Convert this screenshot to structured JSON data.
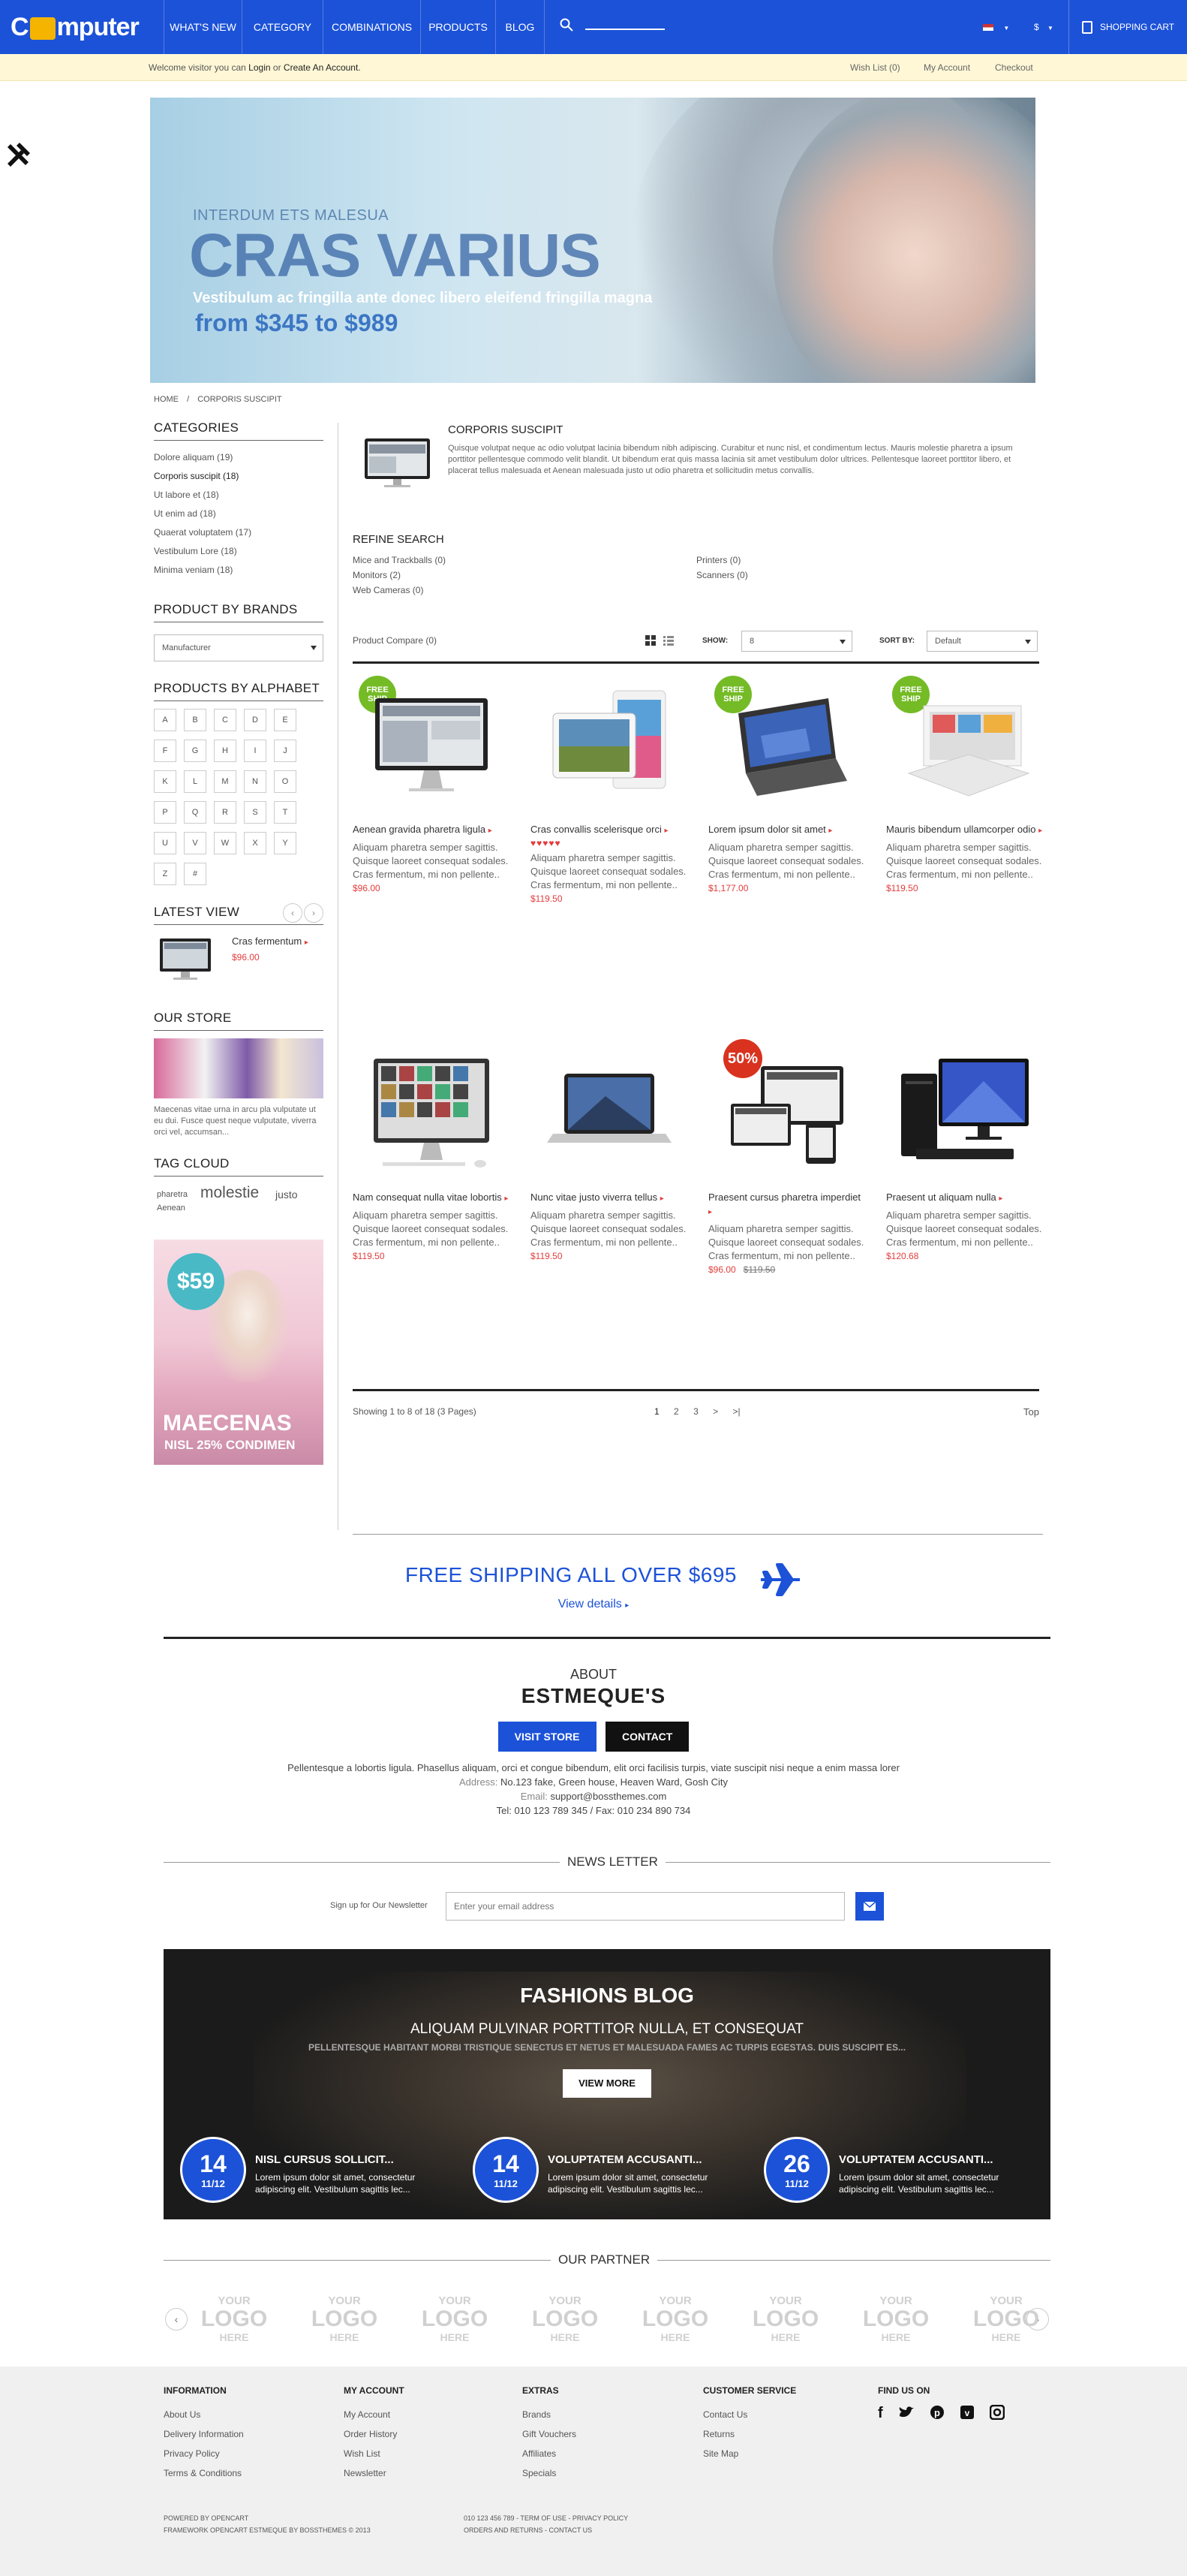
{
  "nav": {
    "logo": "Computer",
    "items": [
      "WHAT'S NEW",
      "CATEGORY",
      "COMBINATIONS",
      "PRODUCTS",
      "BLOG"
    ],
    "currency": "$",
    "cart": "SHOPPING CART"
  },
  "welcome": {
    "prefix": "Welcome visitor you can",
    "login": "Login",
    "or": "or",
    "create": "Create An Account.",
    "links": [
      "Wish List (0)",
      "My Account",
      "Checkout"
    ]
  },
  "banner": {
    "kicker": "INTERDUM ETS MALESUA",
    "title": "CRAS VARIUS",
    "subtitle": "Vestibulum ac fringilla ante donec libero eleifend fringilla magna",
    "price": "from $345 to $989"
  },
  "breadcrumb": {
    "home": "HOME",
    "sep": "/",
    "current": "CORPORIS SUSCIPIT"
  },
  "sidebar": {
    "categories_title": "CATEGORIES",
    "categories": [
      "Dolore aliquam (19)",
      "Corporis suscipit (18)",
      "Ut labore et (18)",
      "Ut enim ad (18)",
      "Quaerat voluptatem (17)",
      "Vestibulum Lore (18)",
      "Minima veniam (18)"
    ],
    "brands_title": "PRODUCT BY BRANDS",
    "brands_select": "Manufacturer",
    "alphabet_title": "PRODUCTS BY ALPHABET",
    "alphabet": [
      "A",
      "B",
      "C",
      "D",
      "E",
      "F",
      "G",
      "H",
      "I",
      "J",
      "K",
      "L",
      "M",
      "N",
      "O",
      "P",
      "Q",
      "R",
      "S",
      "T",
      "U",
      "V",
      "W",
      "X",
      "Y",
      "Z",
      "#"
    ],
    "latest_title": "LATEST VIEW",
    "latest_name": "Cras fermentum",
    "latest_price": "$96.00",
    "store_title": "OUR STORE",
    "store_text": "Maecenas vitae urna in arcu pla vulputate ut eu dui. Fusce quest neque vulputate, viverra orci vel, accumsan...",
    "tag_title": "TAG CLOUD",
    "tags": [
      "pharetra",
      "molestie",
      "justo",
      "Aenean"
    ],
    "promo_price": "$59",
    "promo_title": "MAECENAS",
    "promo_sub": "NISL 25% CONDIMEN"
  },
  "category": {
    "title": "CORPORIS SUSCIPIT",
    "description": "Quisque volutpat neque ac odio volutpat lacinia bibendum nibh adipiscing. Curabitur et nunc nisl, et condimentum lectus. Mauris molestie pharetra a ipsum porttitor pellentesque commodo velit blandit. Ut bibendum erat quis massa lacinia sit amet vestibulum dolor ultrices. Pellentesque laoreet porttitor libero, et placerat tellus malesuada et Aenean malesuada justo ut odio pharetra et sollicitudin metus convallis.",
    "refine_title": "REFINE SEARCH",
    "refine": [
      "Mice and Trackballs (0)",
      "Printers (0)",
      "Monitors (2)",
      "Scanners (0)",
      "Web Cameras (0)"
    ]
  },
  "toolbar": {
    "compare": "Product Compare (0)",
    "show_label": "SHOW:",
    "show_value": "8",
    "sort_label": "SORT BY:",
    "sort_value": "Default"
  },
  "products": [
    {
      "name": "Aenean gravida pharetra ligula",
      "desc": "Aliquam pharetra semper sagittis. Quisque laoreet consequat sodales. Cras fermentum, mi non pellente..",
      "price": "$96.00",
      "badge": "FREE SHIP"
    },
    {
      "name": "Cras convallis scelerisque orci",
      "desc": "Aliquam pharetra semper sagittis. Quisque laoreet consequat sodales. Cras fermentum, mi non pellente..",
      "price": "$119.50",
      "stars": "♥♥♥♥♥"
    },
    {
      "name": "Lorem ipsum dolor sit amet",
      "desc": "Aliquam pharetra semper sagittis. Quisque laoreet consequat sodales. Cras fermentum, mi non pellente..",
      "price": "$1,177.00",
      "badge": "FREE SHIP"
    },
    {
      "name": "Mauris bibendum ullamcorper odio",
      "desc": "Aliquam pharetra semper sagittis. Quisque laoreet consequat sodales. Cras fermentum, mi non pellente..",
      "price": "$119.50",
      "badge": "FREE SHIP"
    },
    {
      "name": "Nam consequat nulla vitae lobortis",
      "desc": "Aliquam pharetra semper sagittis. Quisque laoreet consequat sodales. Cras fermentum, mi non pellente..",
      "price": "$119.50"
    },
    {
      "name": "Nunc vitae justo viverra tellus",
      "desc": "Aliquam pharetra semper sagittis. Quisque laoreet consequat sodales. Cras fermentum, mi non pellente..",
      "price": "$119.50"
    },
    {
      "name": "Praesent cursus pharetra imperdiet",
      "desc": "Aliquam pharetra semper sagittis. Quisque laoreet consequat sodales. Cras fermentum, mi non pellente..",
      "price": "$96.00",
      "old": "$119.50",
      "badge": "50%"
    },
    {
      "name": "Praesent ut aliquam nulla",
      "desc": "Aliquam pharetra semper sagittis. Quisque laoreet consequat sodales. Cras fermentum, mi non pellente..",
      "price": "$120.68"
    }
  ],
  "pager": {
    "info": "Showing 1 to 8 of 18 (3 Pages)",
    "pages": [
      "1",
      "2",
      "3",
      ">",
      ">|"
    ],
    "top": "Top"
  },
  "shipping": {
    "text": "FREE SHIPPING ALL OVER $695",
    "details": "View details"
  },
  "about": {
    "kicker": "ABOUT",
    "title": "ESTMEQUE'S",
    "visit": "VISIT STORE",
    "contact": "CONTACT",
    "text": "Pellentesque a lobortis ligula. Phasellus aliquam, orci et congue bibendum, elit orci facilisis turpis, viate suscipit nisi neque a enim massa lorer",
    "address_label": "Address:",
    "address": "No.123 fake, Green house, Heaven Ward, Gosh City",
    "email_label": "Email:",
    "email": "support@bossthemes.com",
    "tel": "Tel: 010 123 789 345 / Fax: 010 234 890 734"
  },
  "newsletter": {
    "title": "NEWS LETTER",
    "label": "Sign up for Our Newsletter",
    "placeholder": "Enter your email address"
  },
  "blog": {
    "title": "FASHIONS BLOG",
    "headline": "ALIQUAM PULVINAR PORTTITOR NULLA, ET CONSEQUAT",
    "sub": "PELLENTESQUE HABITANT MORBI TRISTIQUE SENECTUS ET NETUS ET MALESUADA FAMES AC TURPIS EGESTAS. DUIS SUSCIPIT ES...",
    "button": "VIEW MORE",
    "posts": [
      {
        "day": "14",
        "month": "11/12",
        "title": "NISL CURSUS SOLLICIT...",
        "text": "Lorem ipsum dolor sit amet, consectetur adipiscing elit. Vestibulum sagittis lec..."
      },
      {
        "day": "14",
        "month": "11/12",
        "title": "VOLUPTATEM ACCUSANTI...",
        "text": "Lorem ipsum dolor sit amet, consectetur adipiscing elit. Vestibulum sagittis lec..."
      },
      {
        "day": "26",
        "month": "11/12",
        "title": "VOLUPTATEM ACCUSANTI...",
        "text": "Lorem ipsum dolor sit amet, consectetur adipiscing elit. Vestibulum sagittis lec..."
      }
    ]
  },
  "partner": {
    "title": "OUR PARTNER",
    "logo_text": [
      "YOUR",
      "LOGO",
      "HERE"
    ]
  },
  "footer": {
    "cols": [
      {
        "title": "INFORMATION",
        "items": [
          "About Us",
          "Delivery Information",
          "Privacy Policy",
          "Terms & Conditions"
        ]
      },
      {
        "title": "MY ACCOUNT",
        "items": [
          "My Account",
          "Order History",
          "Wish List",
          "Newsletter"
        ]
      },
      {
        "title": "EXTRAS",
        "items": [
          "Brands",
          "Gift Vouchers",
          "Affiliates",
          "Specials"
        ]
      },
      {
        "title": "CUSTOMER SERVICE",
        "items": [
          "Contact Us",
          "Returns",
          "Site Map"
        ]
      }
    ],
    "find_title": "FIND US ON",
    "powered1": "POWERED BY OPENCART",
    "powered2": "FRAMEWORK OPENCART ESTMEQUE BY BOSSTHEMES © 2013",
    "links1": "010 123 456 789 - TERM OF USE - PRIVACY POLICY",
    "links2": "ORDERS AND RETURNS - CONTACT US"
  },
  "colors": {
    "brand": "#1c52d8",
    "price": "#e23d3d",
    "badge_green": "#74bb26",
    "sale_red": "#d9321f",
    "welcome_bg": "#fff7d6"
  }
}
